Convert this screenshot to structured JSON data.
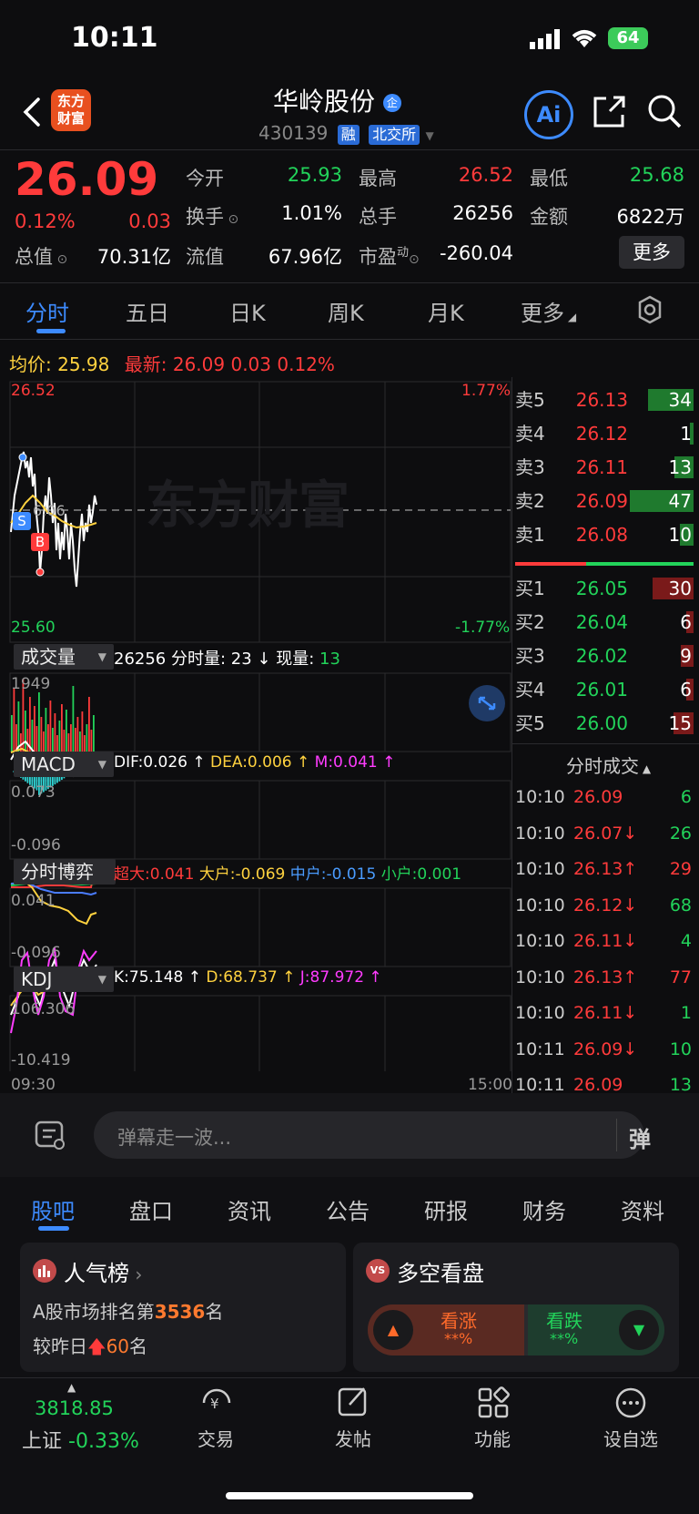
{
  "status": {
    "time": "10:11",
    "battery": "64"
  },
  "header": {
    "logo": "东方财富",
    "title": "华岭股份",
    "title_badge": "企",
    "code": "430139",
    "tag_margin": "融",
    "tag_exchange": "北交所",
    "ai_label": "Ai"
  },
  "quote": {
    "price": "26.09",
    "change_pct": "0.12%",
    "change": "0.03",
    "stats": [
      {
        "label": "今开",
        "value": "25.93",
        "color": "#22d35a"
      },
      {
        "label": "最高",
        "value": "26.52",
        "color": "#ff3b3b"
      },
      {
        "label": "最低",
        "value": "25.68",
        "color": "#22d35a"
      },
      {
        "label": "换手",
        "value": "1.01%",
        "color": "#ffffff"
      },
      {
        "label": "总手",
        "value": "26256",
        "color": "#ffffff"
      },
      {
        "label": "金额",
        "value": "6822万",
        "color": "#ffffff"
      },
      {
        "label": "总值",
        "value": "70.31亿",
        "color": "#ffffff"
      },
      {
        "label": "流值",
        "value": "67.96亿",
        "color": "#ffffff"
      },
      {
        "label": "市盈",
        "value": "-260.04",
        "color": "#ffffff"
      }
    ],
    "pe_sup": "动",
    "more_label": "更多"
  },
  "ktabs": [
    "分时",
    "五日",
    "日K",
    "周K",
    "月K",
    "更多"
  ],
  "intraday": {
    "avg_label": "均价:",
    "avg_value": "25.98",
    "latest_label": "最新:",
    "latest_value": "26.09",
    "latest_change": "0.03",
    "latest_pct": "0.12%",
    "high": "26.52",
    "low": "25.60",
    "high_pct": "1.77%",
    "low_pct": "-1.77%",
    "mid_label": "6.06",
    "watermark": "东方财富",
    "marker_s": "S",
    "marker_b": "B",
    "time_start": "09:30",
    "time_end": "15:00"
  },
  "volume": {
    "label": "成交量",
    "total": "26256",
    "period_label": "分时量: 23",
    "now_label": "现量:",
    "now_value": "13",
    "max": "1949"
  },
  "macd": {
    "label": "MACD",
    "dif": "DIF:0.026",
    "dea": "DEA:0.006",
    "m": "M:0.041",
    "top": "0.073",
    "bottom": "-0.096"
  },
  "game": {
    "label": "分时博弈",
    "super": "超大:0.041",
    "big": "大户:-0.069",
    "mid": "中户:-0.015",
    "small": "小户:0.001",
    "top": "0.041",
    "bottom": "-0.096"
  },
  "kdj": {
    "label": "KDJ",
    "k": "K:75.148",
    "d": "D:68.737",
    "j": "J:87.972",
    "top": "106.306",
    "bottom": "-10.419"
  },
  "orderbook": {
    "asks": [
      {
        "label": "卖5",
        "price": "26.13",
        "vol": "34",
        "fill": 0.72
      },
      {
        "label": "卖4",
        "price": "26.12",
        "vol": "1",
        "fill": 0.0
      },
      {
        "label": "卖3",
        "price": "26.11",
        "vol": "13",
        "fill": 0.3
      },
      {
        "label": "卖2",
        "price": "26.09",
        "vol": "47",
        "fill": 1.0
      },
      {
        "label": "卖1",
        "price": "26.08",
        "vol": "10",
        "fill": 0.22
      }
    ],
    "bids": [
      {
        "label": "买1",
        "price": "26.05",
        "vol": "30",
        "fill": 0.64
      },
      {
        "label": "买2",
        "price": "26.04",
        "vol": "6",
        "fill": 0.12
      },
      {
        "label": "买3",
        "price": "26.02",
        "vol": "9",
        "fill": 0.2
      },
      {
        "label": "买4",
        "price": "26.01",
        "vol": "6",
        "fill": 0.12
      },
      {
        "label": "买5",
        "price": "26.00",
        "vol": "15",
        "fill": 0.32
      }
    ]
  },
  "trades": {
    "title": "分时成交",
    "rows": [
      {
        "time": "10:10",
        "price": "26.09",
        "arrow": "",
        "vol": "6",
        "pcolor": "#ff3b3b",
        "vcolor": "#22d35a"
      },
      {
        "time": "10:10",
        "price": "26.07",
        "arrow": "↓",
        "vol": "26",
        "pcolor": "#ff3b3b",
        "vcolor": "#22d35a"
      },
      {
        "time": "10:10",
        "price": "26.13",
        "arrow": "↑",
        "vol": "29",
        "pcolor": "#ff3b3b",
        "vcolor": "#ff3b3b"
      },
      {
        "time": "10:10",
        "price": "26.12",
        "arrow": "↓",
        "vol": "68",
        "pcolor": "#ff3b3b",
        "vcolor": "#22d35a"
      },
      {
        "time": "10:10",
        "price": "26.11",
        "arrow": "↓",
        "vol": "4",
        "pcolor": "#ff3b3b",
        "vcolor": "#22d35a"
      },
      {
        "time": "10:10",
        "price": "26.13",
        "arrow": "↑",
        "vol": "77",
        "pcolor": "#ff3b3b",
        "vcolor": "#ff3b3b"
      },
      {
        "time": "10:10",
        "price": "26.11",
        "arrow": "↓",
        "vol": "1",
        "pcolor": "#ff3b3b",
        "vcolor": "#22d35a"
      },
      {
        "time": "10:11",
        "price": "26.09",
        "arrow": "↓",
        "vol": "10",
        "pcolor": "#ff3b3b",
        "vcolor": "#22d35a"
      },
      {
        "time": "10:11",
        "price": "26.09",
        "arrow": "",
        "vol": "13",
        "pcolor": "#ff3b3b",
        "vcolor": "#22d35a"
      }
    ]
  },
  "comment": {
    "placeholder": "弹幕走一波...",
    "danmu": "弹"
  },
  "section_tabs": [
    "股吧",
    "盘口",
    "资讯",
    "公告",
    "研报",
    "财务",
    "资料"
  ],
  "popularity": {
    "title": "人气榜",
    "rank_prefix": "A股市场排名第",
    "rank": "3536",
    "rank_suffix": "名",
    "change_prefix": "较昨日",
    "change": "60",
    "change_suffix": "名"
  },
  "longshort": {
    "title": "多空看盘",
    "badge": "VS",
    "bull": "看涨",
    "bull_pct": "**%",
    "bear": "看跌",
    "bear_pct": "**%"
  },
  "bottom_nav": {
    "index_value": "3818.85",
    "index_name": "上证",
    "index_change": "-0.33%",
    "items": [
      "交易",
      "发帖",
      "功能",
      "设自选"
    ]
  }
}
